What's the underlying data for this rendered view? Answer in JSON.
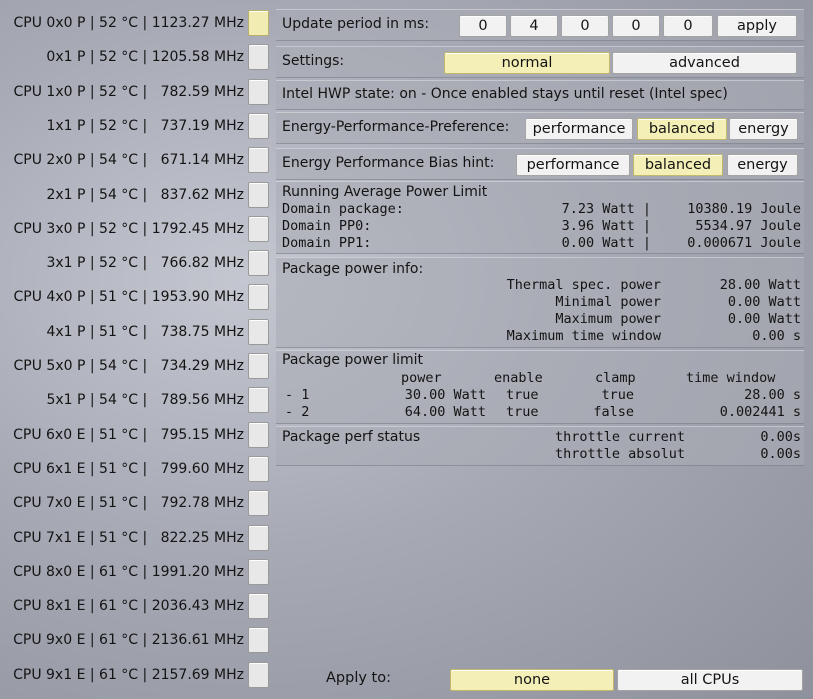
{
  "cpus": [
    {
      "label": "CPU 0x0 P | 52 °C | 1123.27 MHz",
      "selected": true
    },
    {
      "label": "0x1 P | 52 °C | 1205.58 MHz",
      "selected": false
    },
    {
      "label": "CPU 1x0 P | 52 °C |   782.59 MHz",
      "selected": false
    },
    {
      "label": "1x1 P | 52 °C |   737.19 MHz",
      "selected": false
    },
    {
      "label": "CPU 2x0 P | 54 °C |   671.14 MHz",
      "selected": false
    },
    {
      "label": "2x1 P | 54 °C |   837.62 MHz",
      "selected": false
    },
    {
      "label": "CPU 3x0 P | 52 °C | 1792.45 MHz",
      "selected": false
    },
    {
      "label": "3x1 P | 52 °C |   766.82 MHz",
      "selected": false
    },
    {
      "label": "CPU 4x0 P | 51 °C | 1953.90 MHz",
      "selected": false
    },
    {
      "label": "4x1 P | 51 °C |   738.75 MHz",
      "selected": false
    },
    {
      "label": "CPU 5x0 P | 54 °C |   734.29 MHz",
      "selected": false
    },
    {
      "label": "5x1 P | 54 °C |   789.56 MHz",
      "selected": false
    },
    {
      "label": "CPU 6x0 E | 51 °C |   795.15 MHz",
      "selected": false
    },
    {
      "label": "CPU 6x1 E | 51 °C |   799.60 MHz",
      "selected": false
    },
    {
      "label": "CPU 7x0 E | 51 °C |   792.78 MHz",
      "selected": false
    },
    {
      "label": "CPU 7x1 E | 51 °C |   822.25 MHz",
      "selected": false
    },
    {
      "label": "CPU 8x0 E | 61 °C | 1991.20 MHz",
      "selected": false
    },
    {
      "label": "CPU 8x1 E | 61 °C | 2036.43 MHz",
      "selected": false
    },
    {
      "label": "CPU 9x0 E | 61 °C | 2136.61 MHz",
      "selected": false
    },
    {
      "label": "CPU 9x1 E | 61 °C | 2157.69 MHz",
      "selected": false
    }
  ],
  "update": {
    "label": "Update period in ms:",
    "digits": [
      "0",
      "4",
      "0",
      "0",
      "0"
    ],
    "apply": "apply"
  },
  "settings": {
    "label": "Settings:",
    "normal": "normal",
    "advanced": "advanced",
    "selected": "normal"
  },
  "hwp": {
    "text": "Intel HWP state: on - Once enabled stays until reset (Intel spec)"
  },
  "epp": {
    "label": "Energy-Performance-Preference:",
    "performance": "performance",
    "balanced": "balanced",
    "energy": "energy",
    "selected": "balanced"
  },
  "epb": {
    "label": "Energy Performance Bias hint:",
    "performance": "performance",
    "balanced": "balanced",
    "energy": "energy",
    "selected": "balanced"
  },
  "rapl": {
    "title": "Running Average Power Limit",
    "rows": [
      {
        "name": "Domain package:",
        "watt": "7.23 Watt |",
        "joule": "10380.19 Joule"
      },
      {
        "name": "Domain PP0:",
        "watt": "3.96 Watt |",
        "joule": "5534.97 Joule"
      },
      {
        "name": "Domain PP1:",
        "watt": "0.00 Watt |",
        "joule": "0.000671 Joule"
      }
    ]
  },
  "power_info": {
    "title": "Package power info:",
    "rows": [
      {
        "name": "Thermal spec. power",
        "value": "28.00 Watt"
      },
      {
        "name": "Minimal power",
        "value": "0.00 Watt"
      },
      {
        "name": "Maximum power",
        "value": "0.00 Watt"
      },
      {
        "name": "Maximum time window",
        "value": "0.00 s"
      }
    ]
  },
  "power_limit": {
    "title": "Package power limit",
    "headers": {
      "power": "power",
      "enable": "enable",
      "clamp": "clamp",
      "time": "time window"
    },
    "rows": [
      {
        "id": "- 1",
        "power": "30.00 Watt",
        "enable": "true",
        "clamp": "true",
        "time": "28.00 s"
      },
      {
        "id": "- 2",
        "power": "64.00 Watt",
        "enable": "true",
        "clamp": "false",
        "time": "0.002441 s"
      }
    ]
  },
  "perf_status": {
    "title": "Package perf status",
    "rows": [
      {
        "name": "throttle current",
        "value": "0.00s"
      },
      {
        "name": "throttle absolut",
        "value": "0.00s"
      }
    ]
  },
  "apply_to": {
    "label": "Apply to:",
    "none": "none",
    "all": "all CPUs",
    "selected": "none"
  }
}
